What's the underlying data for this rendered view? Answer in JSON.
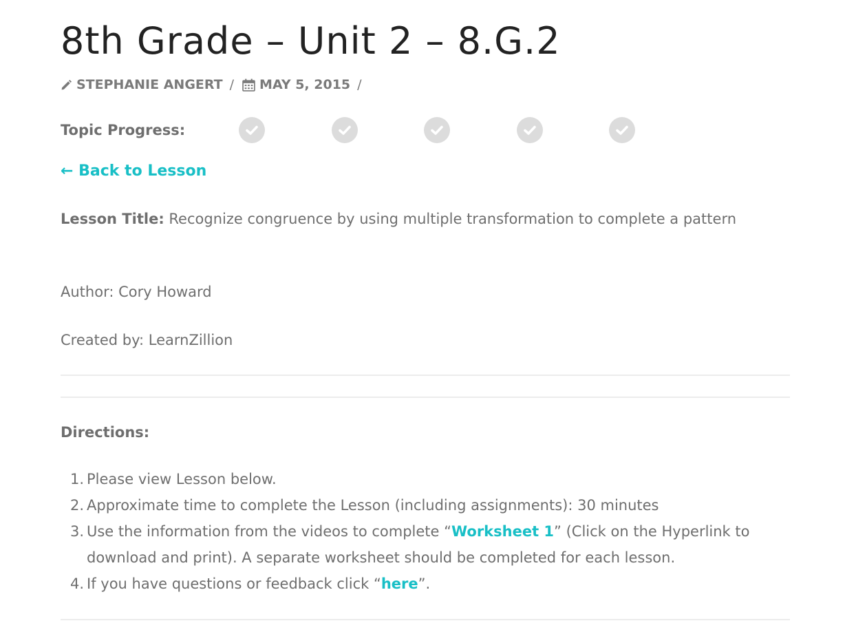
{
  "post": {
    "title": "8th Grade – Unit 2 – 8.G.2",
    "author": "STEPHANIE ANGERT",
    "date": "MAY 5, 2015",
    "meta_separator": "/",
    "author_icon": "pencil-icon",
    "date_icon": "calendar-icon"
  },
  "progress": {
    "label": "Topic Progress:",
    "steps_complete": [
      true,
      true,
      true,
      true,
      true
    ],
    "step_icon": "check-circle-icon",
    "step_color": "#dcdcdc"
  },
  "nav": {
    "back_arrow": "←",
    "back_label": "Back to Lesson"
  },
  "lesson": {
    "title_label": "Lesson Title:",
    "title_value": "Recognize congruence by using multiple transformation to complete a pattern",
    "author_line": "Author: Cory Howard",
    "created_line": "Created by: LearnZillion"
  },
  "directions": {
    "heading": "Directions:",
    "item1": "Please view Lesson below.",
    "item2": "Approximate time to complete the Lesson (including assignments): 30 minutes",
    "item3_before": "Use the information from the videos to complete “",
    "item3_link": "Worksheet 1",
    "item3_after": "” (Click on the Hyperlink to download and print).  A separate worksheet should be completed for each lesson.",
    "item4_before": "If you have questions or feedback click “",
    "item4_link": "here",
    "item4_after": "”."
  },
  "colors": {
    "accent": "#18bfc6",
    "title": "#222222",
    "body_text": "#6e6e6e",
    "divider": "#ececec"
  }
}
